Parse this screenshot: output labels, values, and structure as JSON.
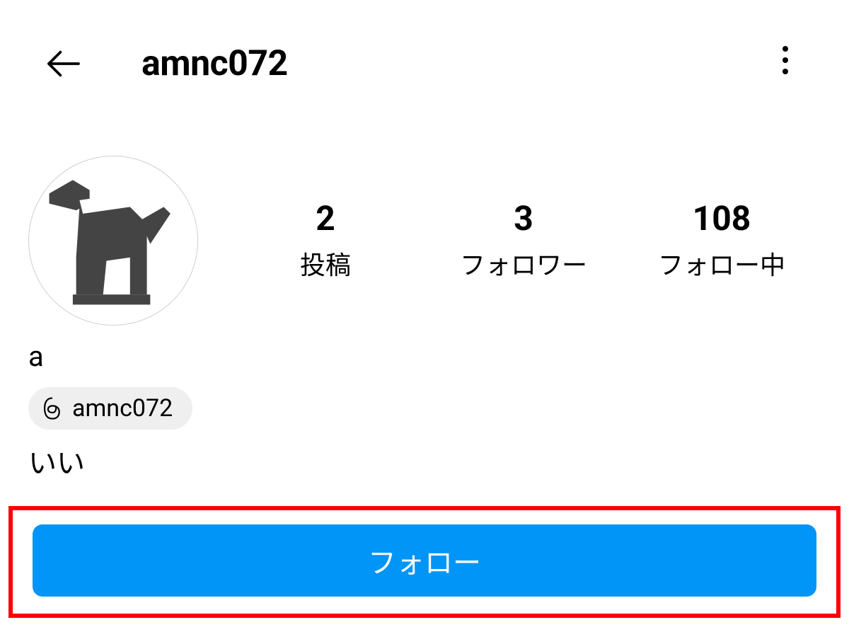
{
  "header": {
    "username": "amnc072"
  },
  "stats": {
    "posts": {
      "count": "2",
      "label": "投稿"
    },
    "followers": {
      "count": "3",
      "label": "フォロワー"
    },
    "following": {
      "count": "108",
      "label": "フォロー中"
    }
  },
  "bio": {
    "display_name": "a",
    "threads_username": "amnc072",
    "text": "いい"
  },
  "actions": {
    "follow_label": "フォロー"
  },
  "colors": {
    "follow_bg": "#0095f6",
    "highlight_border": "#ff0000",
    "badge_bg": "#efefef"
  }
}
